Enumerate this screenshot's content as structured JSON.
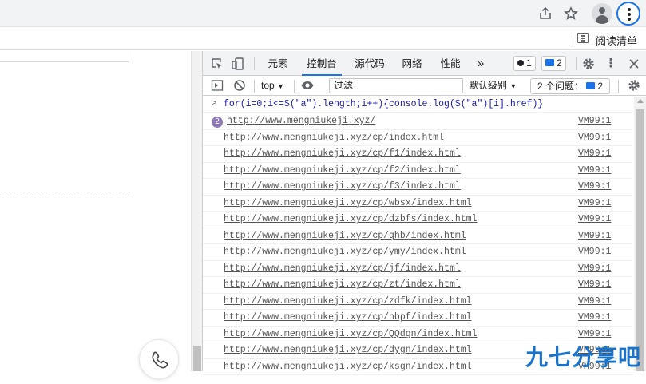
{
  "browser": {
    "share_icon": "share-icon",
    "star_icon": "star-icon",
    "profile_icon": "profile-icon",
    "menu_icon": "kebab-menu-icon",
    "reading_list_label": "阅读清单"
  },
  "devtools": {
    "tabs": [
      "元素",
      "控制台",
      "源代码",
      "网络",
      "性能"
    ],
    "active_tab": "控制台",
    "more_tabs": "»",
    "error_count": "1",
    "message_count": "2",
    "context_selector": "top",
    "filter_placeholder": "过滤",
    "level_selector": "默认级别",
    "issues_label": "2 个问题：",
    "issues_count": "2",
    "command": "for(i=0;i<=$(\"a\").length;i++){console.log($(\"a\")[i].href)}",
    "repeat_count": "2",
    "accent_color": "#1a73e8",
    "logs": [
      {
        "url": "http://www.mengniukeji.xyz/",
        "source": "VM99:1"
      },
      {
        "url": "http://www.mengniukeji.xyz/cp/index.html",
        "source": "VM99:1"
      },
      {
        "url": "http://www.mengniukeji.xyz/cp/f1/index.html",
        "source": "VM99:1"
      },
      {
        "url": "http://www.mengniukeji.xyz/cp/f2/index.html",
        "source": "VM99:1"
      },
      {
        "url": "http://www.mengniukeji.xyz/cp/f3/index.html",
        "source": "VM99:1"
      },
      {
        "url": "http://www.mengniukeji.xyz/cp/wbsx/index.html",
        "source": "VM99:1"
      },
      {
        "url": "http://www.mengniukeji.xyz/cp/dzbfs/index.html",
        "source": "VM99:1"
      },
      {
        "url": "http://www.mengniukeji.xyz/cp/qhb/index.html",
        "source": "VM99:1"
      },
      {
        "url": "http://www.mengniukeji.xyz/cp/ymy/index.html",
        "source": "VM99:1"
      },
      {
        "url": "http://www.mengniukeji.xyz/cp/jf/index.html",
        "source": "VM99:1"
      },
      {
        "url": "http://www.mengniukeji.xyz/cp/zt/index.html",
        "source": "VM99:1"
      },
      {
        "url": "http://www.mengniukeji.xyz/cp/zdfk/index.html",
        "source": "VM99:1"
      },
      {
        "url": "http://www.mengniukeji.xyz/cp/hbpf/index.html",
        "source": "VM99:1"
      },
      {
        "url": "http://www.mengniukeji.xyz/cp/QQdgn/index.html",
        "source": "VM99:1"
      },
      {
        "url": "http://www.mengniukeji.xyz/cp/dygn/index.html",
        "source": "VM99:1"
      },
      {
        "url": "http://www.mengniukeji.xyz/cp/ksgn/index.html",
        "source": "VM99:1"
      }
    ]
  },
  "watermark": "九七分享吧"
}
